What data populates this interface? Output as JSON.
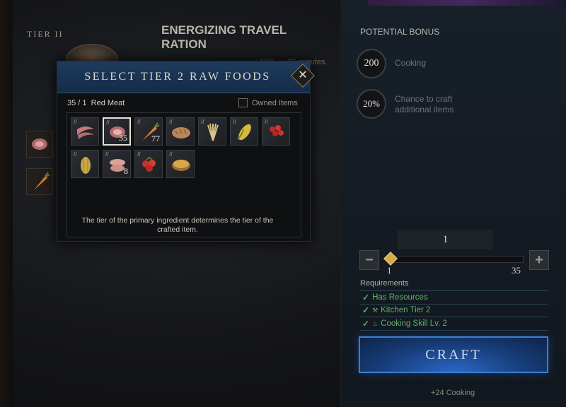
{
  "recipe": {
    "tier_label": "TIER II",
    "title": "ENERGIZING TRAVEL RATION",
    "subtitle": "+15% … 25 minutes."
  },
  "modal": {
    "title": "SELECT TIER 2 RAW FOODS",
    "close_glyph": "✕",
    "count": "35 / 1",
    "selected_name": "Red Meat",
    "owned_label": "Owned Items",
    "hint": "The tier of the primary ingredient determines the tier of the crafted item.",
    "items": [
      {
        "name": "raw-bacon",
        "tier": "II",
        "qty": ""
      },
      {
        "name": "red-meat",
        "tier": "II",
        "qty": "35"
      },
      {
        "name": "carrot",
        "tier": "II",
        "qty": "77"
      },
      {
        "name": "bread",
        "tier": "II",
        "qty": ""
      },
      {
        "name": "wheat",
        "tier": "II",
        "qty": ""
      },
      {
        "name": "corn",
        "tier": "II",
        "qty": ""
      },
      {
        "name": "berries",
        "tier": "II",
        "qty": ""
      },
      {
        "name": "squash",
        "tier": "II",
        "qty": ""
      },
      {
        "name": "poultry",
        "tier": "II",
        "qty": "8"
      },
      {
        "name": "tomatoes",
        "tier": "II",
        "qty": ""
      },
      {
        "name": "pie",
        "tier": "II",
        "qty": ""
      }
    ]
  },
  "bonus": {
    "title": "POTENTIAL BONUS",
    "cooking_value": "200",
    "cooking_label": "Cooking",
    "chance_value": "20%",
    "chance_label_1": "Chance to craft",
    "chance_label_2": "additional items"
  },
  "quantity": {
    "value": "1",
    "min": "1",
    "max": "35",
    "minus": "−",
    "plus": "+"
  },
  "requirements": {
    "title": "Requirements",
    "items": [
      "Has Resources",
      "Kitchen Tier 2",
      "Cooking Skill Lv. 2"
    ]
  },
  "craft_label": "CRAFT",
  "xp_text": "+24 Cooking",
  "colors": {
    "accent_blue": "#2a67c5",
    "requirement_green": "#5fb06e",
    "slider_gold": "#d6a94a"
  }
}
